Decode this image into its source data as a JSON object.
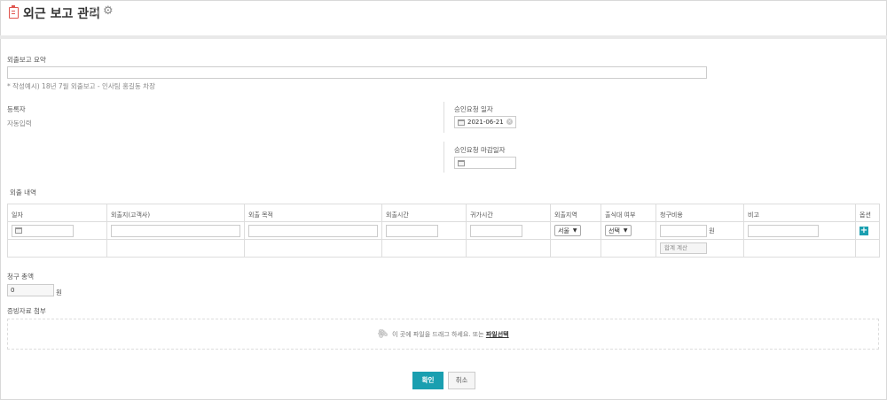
{
  "header": {
    "title": "외근 보고 관리",
    "info_icon": "info-icon",
    "gear_icon": "gear-icon",
    "title_icon": "clipboard-icon",
    "title_icon_color": "#e0554f"
  },
  "summary": {
    "label": "외출보고 요약",
    "value": "",
    "hint": "* 작성예시) 18년 7월 외출보고 - 인사팀 홍길동 차장"
  },
  "registrant": {
    "label": "등록자",
    "value": "자동입력"
  },
  "approval_date": {
    "label": "승인요청 일자",
    "value": "2021-06-21"
  },
  "approval_deadline": {
    "label": "승인요청 마감일자",
    "value": ""
  },
  "outing": {
    "section_label": "외출 내역",
    "columns": [
      "일자",
      "외출지(고객사)",
      "외출 목적",
      "외출시간",
      "귀가시간",
      "외출지역",
      "출식대 여부",
      "청구비용",
      "비고",
      "옵션"
    ],
    "region_select": "서울",
    "meal_select": "선택",
    "currency_unit": "원",
    "calc_button": "합계 계산"
  },
  "total": {
    "label": "청구 총액",
    "value": "0",
    "unit": "원"
  },
  "attachment": {
    "label": "증빙자료 첨부",
    "drop_text": "이 곳에 파일을 드래그 하세요. 또는",
    "select_link": "파일선택"
  },
  "actions": {
    "confirm": "확인",
    "cancel": "취소"
  },
  "colors": {
    "accent": "#1a9fb0"
  }
}
